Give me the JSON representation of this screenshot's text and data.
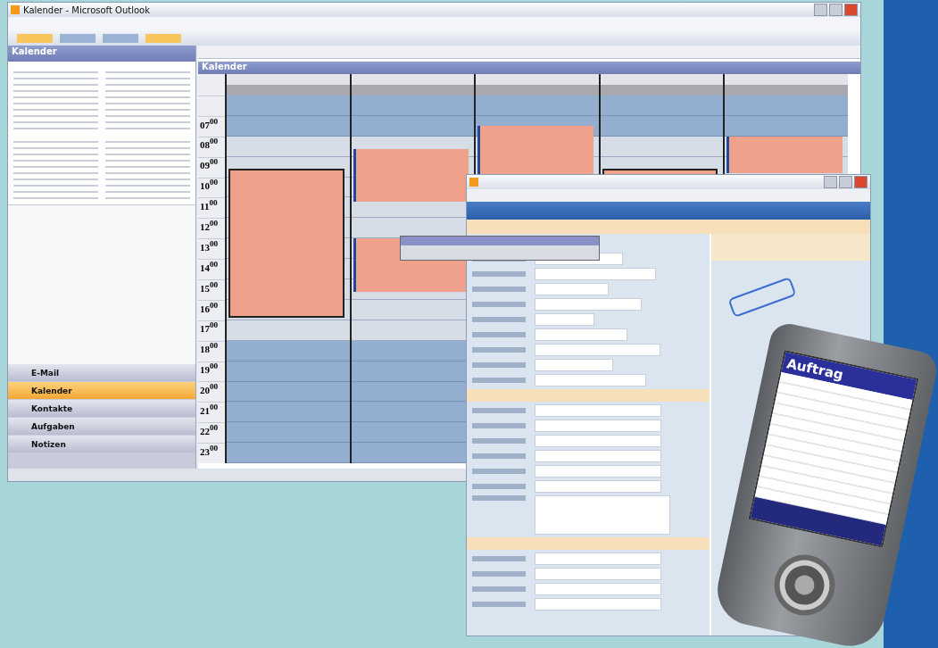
{
  "outlook": {
    "title": "Kalender - Microsoft Outlook",
    "pane_title": "Kalender",
    "calendar_title": "Kalender",
    "time_slots": [
      "07$^{00}$",
      "08$^{00}$",
      "09$^{00}$",
      "10$^{00}$",
      "11$^{00}$",
      "12$^{00}$",
      "13$^{00}$",
      "14$^{00}$",
      "15$^{00}$",
      "16$^{00}$",
      "17$^{00}$",
      "18$^{00}$",
      "19$^{00}$",
      "20$^{00}$",
      "21$^{00}$",
      "22$^{00}$",
      "23$^{00}$"
    ],
    "nav_items": [
      {
        "label": "E-Mail",
        "selected": false
      },
      {
        "label": "Kalender",
        "selected": true
      },
      {
        "label": "Kontakte",
        "selected": false
      },
      {
        "label": "Aufgaben",
        "selected": false
      },
      {
        "label": "Notizen",
        "selected": false
      }
    ]
  },
  "phone": {
    "screen_title": "Auftrag"
  }
}
